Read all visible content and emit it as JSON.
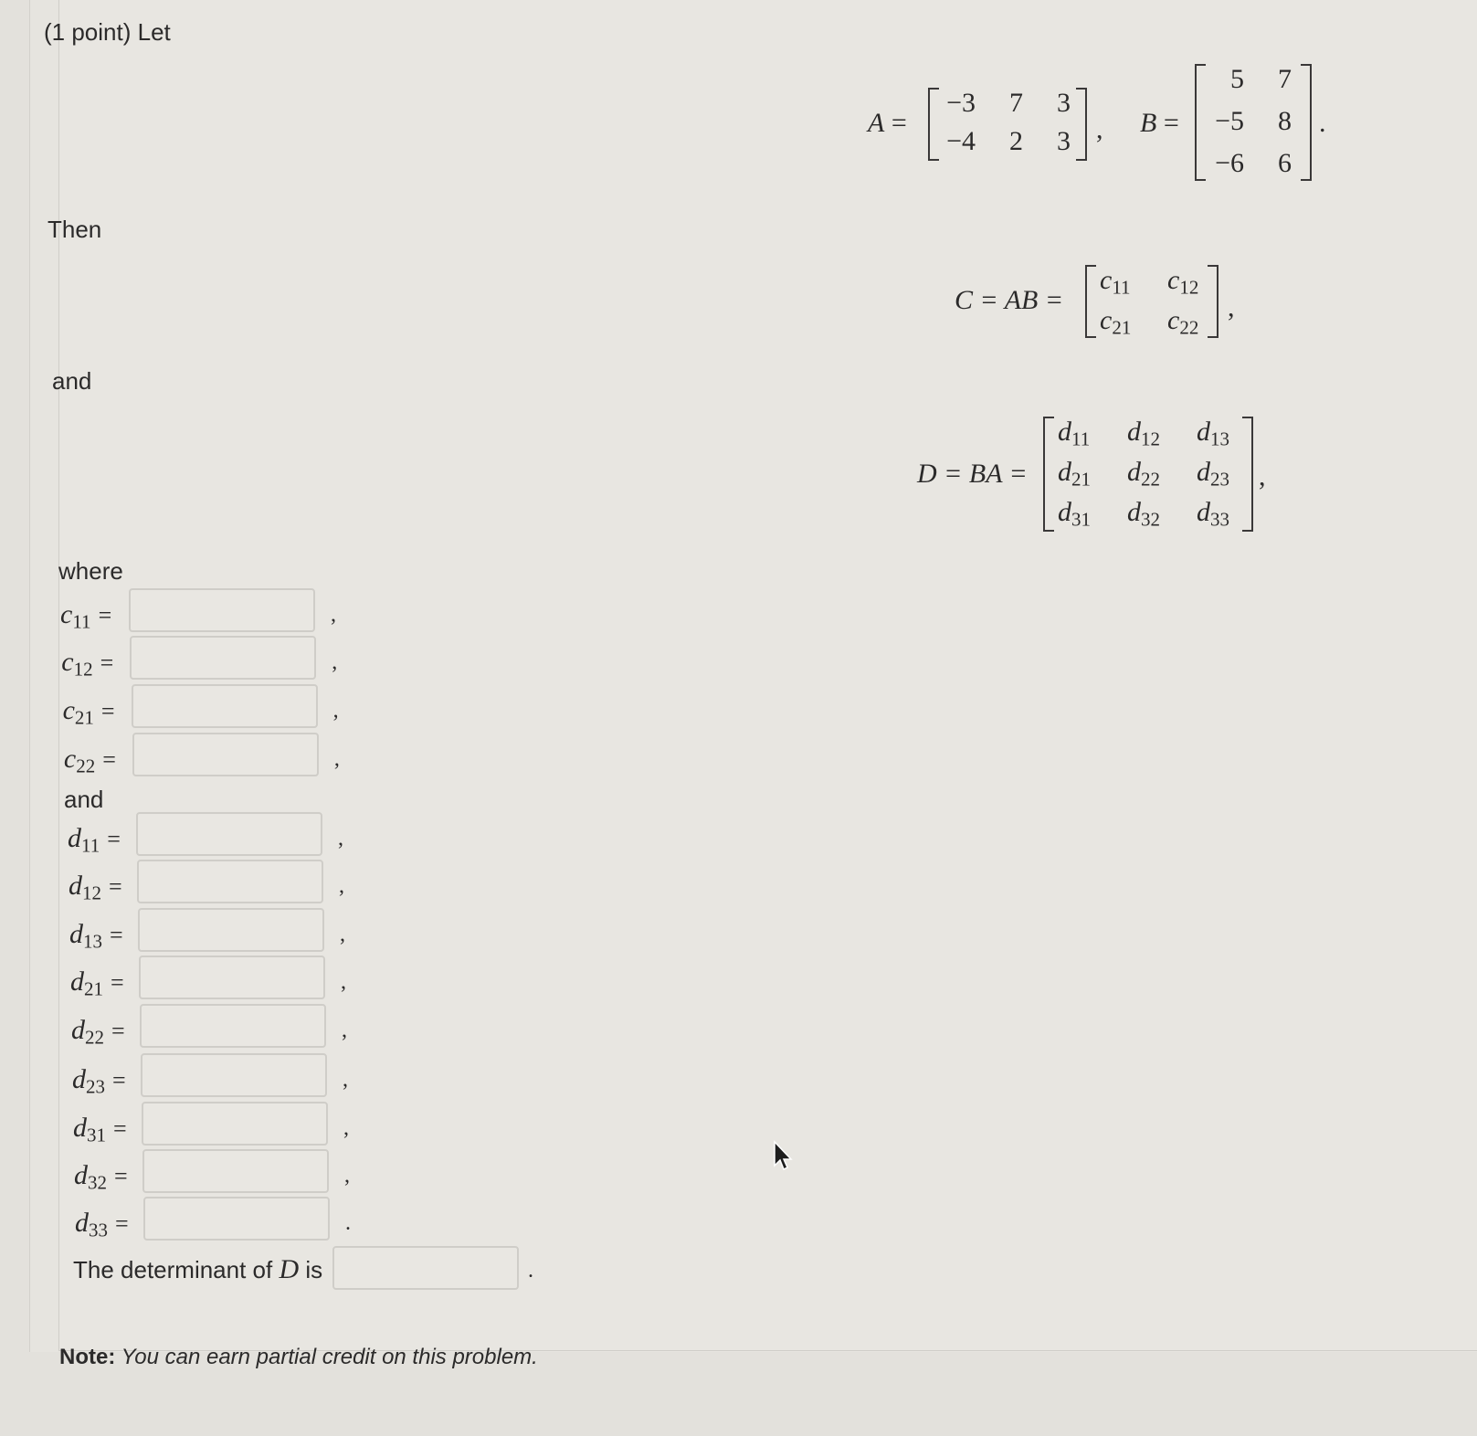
{
  "problem": {
    "intro": "(1 point) Let",
    "then": "Then",
    "and1": "and",
    "where": "where",
    "and2": "and",
    "det_label_pre": "The determinant of ",
    "det_label_var": "D",
    "det_label_post": " is",
    "note_bold": "Note:",
    "note_text": " You can earn partial credit on this problem."
  },
  "matrices": {
    "A": {
      "name": "A",
      "rows": [
        [
          "−3",
          "7",
          "3"
        ],
        [
          "−4",
          "2",
          "3"
        ]
      ]
    },
    "B": {
      "name": "B",
      "rows": [
        [
          "5",
          "7"
        ],
        [
          "−5",
          "8"
        ],
        [
          "−6",
          "6"
        ]
      ]
    },
    "C": {
      "lhs": "C = AB =",
      "rows": [
        [
          "c11",
          "c12"
        ],
        [
          "c21",
          "c22"
        ]
      ]
    },
    "D": {
      "lhs": "D = BA =",
      "rows": [
        [
          "d11",
          "d12",
          "d13"
        ],
        [
          "d21",
          "d22",
          "d23"
        ],
        [
          "d31",
          "d32",
          "d33"
        ]
      ]
    }
  },
  "answers": [
    {
      "var": "c",
      "sub": "11",
      "value": "",
      "punct": ","
    },
    {
      "var": "c",
      "sub": "12",
      "value": "",
      "punct": ","
    },
    {
      "var": "c",
      "sub": "21",
      "value": "",
      "punct": ","
    },
    {
      "var": "c",
      "sub": "22",
      "value": "",
      "punct": ","
    },
    {
      "var": "d",
      "sub": "11",
      "value": "",
      "punct": ","
    },
    {
      "var": "d",
      "sub": "12",
      "value": "",
      "punct": ","
    },
    {
      "var": "d",
      "sub": "13",
      "value": "",
      "punct": ","
    },
    {
      "var": "d",
      "sub": "21",
      "value": "",
      "punct": ","
    },
    {
      "var": "d",
      "sub": "22",
      "value": "",
      "punct": ","
    },
    {
      "var": "d",
      "sub": "23",
      "value": "",
      "punct": ","
    },
    {
      "var": "d",
      "sub": "31",
      "value": "",
      "punct": ","
    },
    {
      "var": "d",
      "sub": "32",
      "value": "",
      "punct": ","
    },
    {
      "var": "d",
      "sub": "33",
      "value": "",
      "punct": "."
    }
  ],
  "determinant": {
    "value": "",
    "punct": "."
  }
}
